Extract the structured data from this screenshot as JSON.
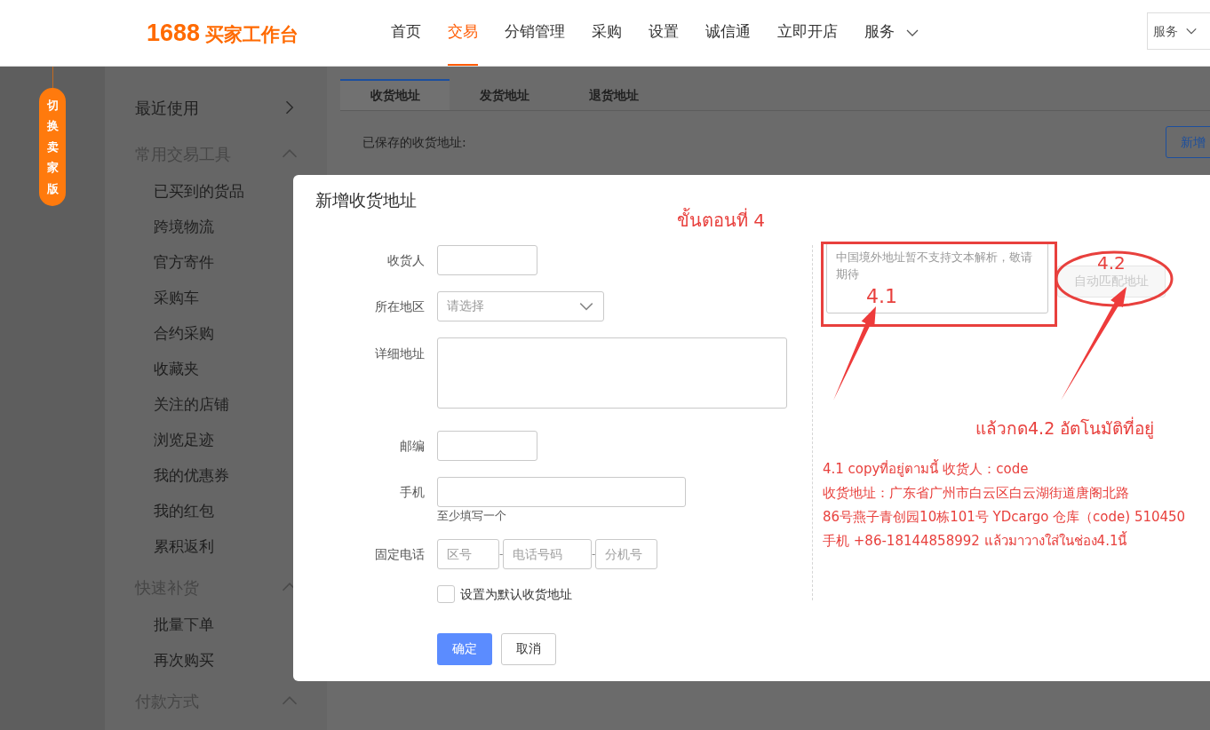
{
  "header": {
    "logo_number": "1688",
    "logo_text": "买家工作台",
    "nav": [
      {
        "label": "首页",
        "selected": false
      },
      {
        "label": "交易",
        "selected": true
      },
      {
        "label": "分销管理",
        "selected": false
      },
      {
        "label": "采购",
        "selected": false
      },
      {
        "label": "设置",
        "selected": false
      },
      {
        "label": "诚信通",
        "selected": false
      },
      {
        "label": "立即开店",
        "selected": false
      },
      {
        "label": "服务",
        "selected": false,
        "dropdown": true
      }
    ],
    "service_select": "服务"
  },
  "switch_badge": "切换卖家版",
  "sidebar": [
    {
      "label": "最近使用",
      "kind": "link"
    },
    {
      "label": "常用交易工具",
      "kind": "group",
      "expanded": true,
      "children": [
        "已买到的货品",
        "跨境物流",
        "官方寄件",
        "采购车",
        "合约采购",
        "收藏夹",
        "关注的店铺",
        "浏览足迹",
        "我的优惠券",
        "我的红包",
        "累积返利"
      ]
    },
    {
      "label": "快速补货",
      "kind": "group",
      "expanded": true,
      "children": [
        "批量下单",
        "再次购买"
      ]
    },
    {
      "label": "付款方式",
      "kind": "group",
      "expanded": true
    }
  ],
  "tabs": [
    {
      "label": "收货地址",
      "selected": true
    },
    {
      "label": "发货地址",
      "selected": false
    },
    {
      "label": "退货地址",
      "selected": false
    }
  ],
  "saved_label": "已保存的收货地址:",
  "add_button": "新增",
  "dialog": {
    "title": "新增收货地址",
    "form": [
      {
        "label": "收货人",
        "kind": "short"
      },
      {
        "label": "所在地区",
        "kind": "select",
        "placeholder": "请选择"
      },
      {
        "label": "详细地址",
        "kind": "textarea"
      },
      {
        "label": "邮编",
        "kind": "short"
      },
      {
        "label": "手机",
        "kind": "wide",
        "hint": "至少填写一个"
      },
      {
        "label": "固定电话",
        "kind": "phone",
        "parts": [
          {
            "placeholder": "区号"
          },
          {
            "separator": "-",
            "placeholder": "电话号码"
          },
          {
            "separator": "-",
            "placeholder": "分机号"
          }
        ]
      }
    ],
    "default_checkbox": {
      "label": "设置为默认收货地址",
      "checked": false
    },
    "parse_box": {
      "placeholder": "中国境外地址暂不支持文本解析，敬请期待"
    },
    "match_button": {
      "label": "自动匹配地址",
      "disabled": true
    },
    "buttons": [
      {
        "label": "确定",
        "kind": "primary"
      },
      {
        "label": "取消",
        "kind": "secondary"
      }
    ]
  },
  "annotations": {
    "step_title": "ขั้นตอนที่ 4",
    "box_label": "4.1",
    "ellipse_label": "4.2",
    "instruction_lines": [
      "4.1 copyที่อยู่ตามนี้ 收货人：code",
      "收货地址：广东省广州市白云区白云湖街道唐阁北路",
      "86号燕子青创园10栋101号 YDcargo 仓库（code) 510450",
      "手机 +86-18144858992  แล้วมาวางใส่ในช่อง4.1นี้"
    ],
    "note": "แล้วกด4.2 อัตโนมัติที่อยู่"
  }
}
